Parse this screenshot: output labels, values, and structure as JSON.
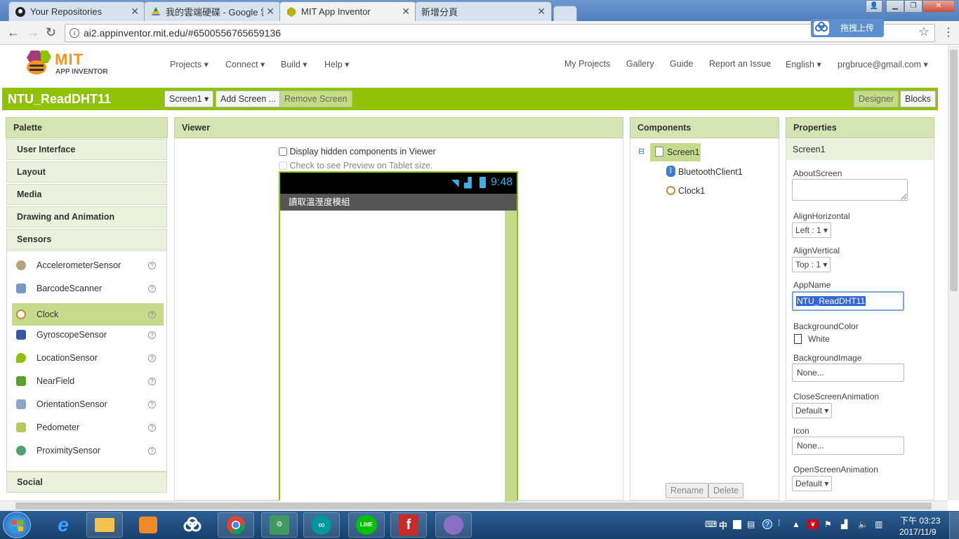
{
  "browser": {
    "tabs": [
      {
        "title": "Your Repositories",
        "active": false
      },
      {
        "title": "我的雲端硬碟 - Google 雲",
        "active": false
      },
      {
        "title": "MIT App Inventor",
        "active": true
      },
      {
        "title": "新增分頁",
        "active": false
      }
    ],
    "url": "ai2.appinventor.mit.edu/#6500556765659136",
    "upload_label": "拖拽上传"
  },
  "header": {
    "logo_top": "MIT",
    "logo_bottom": "APP INVENTOR",
    "menus": [
      "Projects ▾",
      "Connect ▾",
      "Build ▾",
      "Help ▾"
    ],
    "right_links": [
      "My Projects",
      "Gallery",
      "Guide",
      "Report an Issue",
      "English ▾",
      "prgbruce@gmail.com ▾"
    ]
  },
  "project": {
    "name": "NTU_ReadDHT11",
    "screen_select": "Screen1 ▾",
    "add_screen": "Add Screen ...",
    "remove_screen": "Remove Screen",
    "designer": "Designer",
    "blocks": "Blocks"
  },
  "palette": {
    "title": "Palette",
    "categories_top": [
      "User Interface",
      "Layout",
      "Media",
      "Drawing and Animation",
      "Sensors"
    ],
    "sensors": [
      "AccelerometerSensor",
      "BarcodeScanner",
      "Clock",
      "GyroscopeSensor",
      "LocationSensor",
      "NearField",
      "OrientationSensor",
      "Pedometer",
      "ProximitySensor"
    ],
    "selected": "Clock",
    "category_bottom": "Social",
    "help": "?"
  },
  "viewer": {
    "title": "Viewer",
    "hidden_checkbox": "Display hidden components in Viewer",
    "tablet_checkbox": "Check to see Preview on Tablet size.",
    "phone_time": "9:48",
    "screen_title": "讀取溫溼度模組"
  },
  "components": {
    "title": "Components",
    "root": "Screen1",
    "children": [
      "BluetoothClient1",
      "Clock1"
    ],
    "collapse": "⊟",
    "rename": "Rename",
    "delete": "Delete"
  },
  "properties": {
    "title": "Properties",
    "screen": "Screen1",
    "about_label": "AboutScreen",
    "align_h_label": "AlignHorizontal",
    "align_h_value": "Left : 1 ▾",
    "align_v_label": "AlignVertical",
    "align_v_value": "Top : 1 ▾",
    "appname_label": "AppName",
    "appname_value": "NTU_ReadDHT11",
    "bgcolor_label": "BackgroundColor",
    "bgcolor_value": "White",
    "bgimage_label": "BackgroundImage",
    "bgimage_value": "None...",
    "close_anim_label": "CloseScreenAnimation",
    "close_anim_value": "Default ▾",
    "icon_label": "Icon",
    "icon_value": "None...",
    "open_anim_label": "OpenScreenAnimation",
    "open_anim_value": "Default ▾"
  },
  "taskbar": {
    "ime": "中",
    "time": "下午 03:23",
    "date": "2017/11/9"
  },
  "colors": {
    "accent_green": "#8fc202",
    "panel_header": "#d5e4b3",
    "selected_row": "#c6dc8c"
  }
}
